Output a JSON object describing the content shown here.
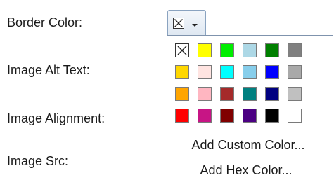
{
  "form": {
    "labels": {
      "border_color": "Border Color:",
      "image_alt_text": "Image Alt Text:",
      "image_alignment": "Image Alignment:",
      "image_src": "Image Src:"
    }
  },
  "color_picker": {
    "button_icon": "no-color-icon",
    "dropdown_icon": "chevron-down-icon",
    "swatches": [
      "none",
      "#ffff00",
      "#00ee00",
      "#add8e6",
      "#008000",
      "#808080",
      "#ffd700",
      "#ffe4e1",
      "#00ffff",
      "#87ceeb",
      "#0000ff",
      "#a9a9a9",
      "#ffa500",
      "#ffb6c1",
      "#a52a2a",
      "#008080",
      "#000080",
      "#c0c0c0",
      "#ff0000",
      "#c71585",
      "#800000",
      "#4b0082",
      "#000000",
      "#ffffff"
    ],
    "add_custom_label": "Add Custom Color...",
    "add_hex_label": "Add Hex Color..."
  }
}
